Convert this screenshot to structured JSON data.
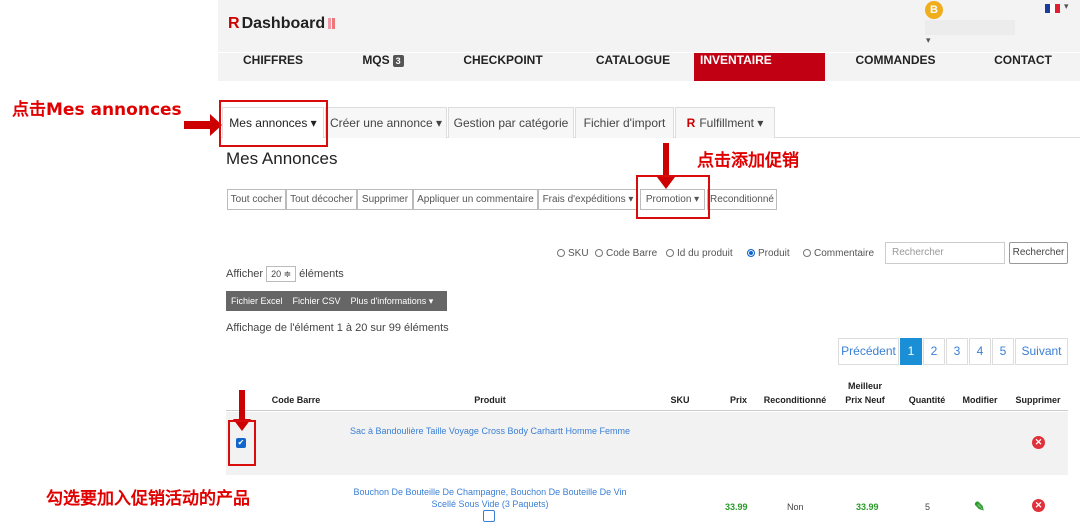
{
  "header": {
    "logo_r": "R",
    "logo_text": "Dashboard",
    "avatar_letter": "B",
    "caret": "▾"
  },
  "nav": [
    {
      "label": "CHIFFRES"
    },
    {
      "label": "MQS",
      "badge": "3"
    },
    {
      "label": "CHECKPOINT"
    },
    {
      "label": "CATALOGUE"
    },
    {
      "label": "INVENTAIRE",
      "active": true
    },
    {
      "label": "COMMANDES"
    },
    {
      "label": "CONTACT"
    }
  ],
  "tabs": {
    "mes_annonces": "Mes annonces ▾",
    "creer": "Créer une annonce ▾",
    "gestion": "Gestion par catégorie",
    "fichier": "Fichier d'import",
    "fulfillment_r": "R",
    "fulfillment": "Fulfillment ▾"
  },
  "page_title": "Mes Annonces",
  "action_buttons": [
    "Tout cocher",
    "Tout décocher",
    "Supprimer",
    "Appliquer un commentaire",
    "Frais d'expéditions ▾",
    "Promotion ▾",
    "Reconditionné"
  ],
  "search": {
    "options": [
      {
        "label": "SKU",
        "checked": false
      },
      {
        "label": "Code Barre",
        "checked": false
      },
      {
        "label": "Id du produit",
        "checked": false
      },
      {
        "label": "Produit",
        "checked": true
      },
      {
        "label": "Commentaire",
        "checked": false
      }
    ],
    "placeholder": "Rechercher",
    "button": "Rechercher"
  },
  "show": {
    "prefix": "Afficher",
    "value": "20 ≑",
    "suffix": "éléments"
  },
  "export": [
    "Fichier Excel",
    "Fichier CSV",
    "Plus d'informations ▾"
  ],
  "info": "Affichage de l'élément 1 à 20 sur 99 éléments",
  "pagination": {
    "prev": "Précédent",
    "pages": [
      "1",
      "2",
      "3",
      "4",
      "5"
    ],
    "next": "Suivant",
    "current": "1"
  },
  "table": {
    "headers": {
      "code": "Code Barre",
      "produit": "Produit",
      "sku": "SKU",
      "prix": "Prix",
      "recond": "Reconditionné",
      "meilleur1": "Meilleur",
      "meilleur2": "Prix Neuf",
      "quantite": "Quantité",
      "modifier": "Modifier",
      "supprimer": "Supprimer"
    },
    "rows": [
      {
        "checked": true,
        "produit": "Sac à Bandoulière Taille Voyage Cross Body Carhartt Homme Femme",
        "sku": "",
        "prix": "",
        "recond": "",
        "meilleur": "",
        "quantite": ""
      },
      {
        "checked": false,
        "produit": "Bouchon De Bouteille De Champagne, Bouchon De Bouteille De Vin Scellé Sous Vide (3 Paquets)",
        "sku": "",
        "prix": "33.99",
        "recond": "Non",
        "meilleur": "33.99",
        "quantite": "5"
      }
    ]
  },
  "annotations": {
    "click_mes_annonces": "点击Mes annonces",
    "click_promo": "点击添加促销",
    "select_products": "勾选要加入促销活动的产品"
  },
  "colors": {
    "accent": "#c20013",
    "link": "#3a7fd5",
    "annotation": "#e00000"
  }
}
